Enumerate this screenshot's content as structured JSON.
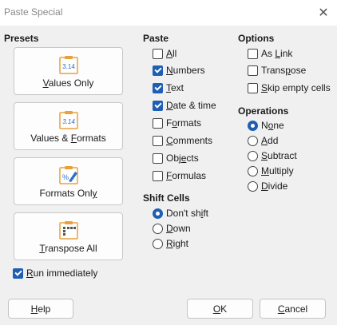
{
  "window": {
    "title": "Paste Special",
    "close_glyph": "✕"
  },
  "presets": {
    "title": "Presets",
    "buttons": [
      {
        "label_pre": "",
        "label_u": "V",
        "label_post": "alues Only",
        "icon": "clipboard-number-icon"
      },
      {
        "label_pre": "Values & ",
        "label_u": "F",
        "label_post": "ormats",
        "icon": "clipboard-number-formatted-icon"
      },
      {
        "label_pre": "Formats Onl",
        "label_u": "y",
        "label_post": "",
        "icon": "clipboard-format-brush-icon"
      },
      {
        "label_pre": "",
        "label_u": "T",
        "label_post": "ranspose All",
        "icon": "clipboard-transpose-icon"
      }
    ],
    "icon_number": "3.14"
  },
  "run_immediately": {
    "pre": "",
    "u": "R",
    "post": "un immediately",
    "checked": true
  },
  "paste": {
    "title": "Paste",
    "items": [
      {
        "pre": "",
        "u": "A",
        "post": "ll",
        "checked": false
      },
      {
        "pre": "",
        "u": "N",
        "post": "umbers",
        "checked": true
      },
      {
        "pre": "",
        "u": "T",
        "post": "ext",
        "checked": true
      },
      {
        "pre": "",
        "u": "D",
        "post": "ate & time",
        "checked": true
      },
      {
        "pre": "F",
        "u": "o",
        "post": "rmats",
        "checked": false
      },
      {
        "pre": "",
        "u": "C",
        "post": "omments",
        "checked": false
      },
      {
        "pre": "Obj",
        "u": "e",
        "post": "cts",
        "checked": false
      },
      {
        "pre": "",
        "u": "F",
        "post": "ormulas",
        "checked": false
      }
    ]
  },
  "shift": {
    "title": "Shift Cells",
    "items": [
      {
        "pre": "Don't sh",
        "u": "i",
        "post": "ft",
        "selected": true
      },
      {
        "pre": "",
        "u": "D",
        "post": "own",
        "selected": false
      },
      {
        "pre": "",
        "u": "R",
        "post": "ight",
        "selected": false
      }
    ]
  },
  "options": {
    "title": "Options",
    "items": [
      {
        "pre": "As ",
        "u": "L",
        "post": "ink",
        "checked": false
      },
      {
        "pre": "Trans",
        "u": "p",
        "post": "ose",
        "checked": false
      },
      {
        "pre": "",
        "u": "S",
        "post": "kip empty cells",
        "checked": false
      }
    ]
  },
  "operations": {
    "title": "Operations",
    "items": [
      {
        "pre": "N",
        "u": "o",
        "post": "ne",
        "selected": true
      },
      {
        "pre": "",
        "u": "A",
        "post": "dd",
        "selected": false
      },
      {
        "pre": "",
        "u": "S",
        "post": "ubtract",
        "selected": false
      },
      {
        "pre": "",
        "u": "M",
        "post": "ultiply",
        "selected": false
      },
      {
        "pre": "",
        "u": "D",
        "post": "ivide",
        "selected": false
      }
    ]
  },
  "footer": {
    "help": {
      "pre": "",
      "u": "H",
      "post": "elp"
    },
    "ok": {
      "pre": "",
      "u": "O",
      "post": "K"
    },
    "cancel": {
      "pre": "",
      "u": "C",
      "post": "ancel"
    }
  },
  "colors": {
    "accent": "#1e5fb4",
    "icon_orange": "#e9a23b",
    "icon_blue": "#2a6fc9"
  }
}
